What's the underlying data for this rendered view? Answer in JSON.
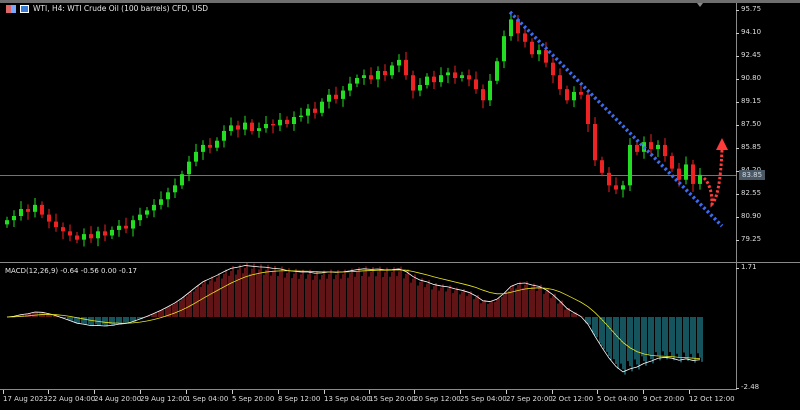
{
  "window": {
    "title": "WTI, H4:  WTI Crude Oil (100 barrels) CFD, USD"
  },
  "indicator": {
    "label": "MACD(12,26,9) -0.64 -0.56 0.00 -0.17",
    "max_label": "1.71",
    "min_label": "-2.48",
    "fast": 12,
    "slow": 26,
    "signal": 9
  },
  "price_axis": {
    "labels": [
      "95.75",
      "94.10",
      "92.45",
      "90.80",
      "89.15",
      "87.50",
      "85.85",
      "84.20",
      "82.55",
      "80.90",
      "79.25"
    ],
    "current_price": "83.85"
  },
  "time_axis": {
    "labels": [
      "17 Aug 2023",
      "22 Aug 04:00",
      "24 Aug 20:00",
      "29 Aug 12:00",
      "1 Sep 04:00",
      "5 Sep 20:00",
      "8 Sep 12:00",
      "13 Sep 04:00",
      "15 Sep 20:00",
      "20 Sep 12:00",
      "25 Sep 04:00",
      "27 Sep 20:00",
      "2 Oct 12:00",
      "5 Oct 04:00",
      "9 Oct 20:00",
      "12 Oct 12:00"
    ]
  },
  "colors": {
    "bull": "#22dd22",
    "bear": "#ee2222",
    "trendline": "#3b6cf0",
    "arrow": "#ff3b3b",
    "macd": "#ffffff",
    "signal": "#e8e820",
    "hist_pos": "#c0282a",
    "hist_neg": "#2aa8b8"
  },
  "chart_data": {
    "type": "candlestick",
    "symbol": "WTI",
    "timeframe": "H4",
    "ylim": [
      78.6,
      96.1
    ],
    "closes": [
      80.6,
      80.9,
      81.4,
      81.2,
      81.7,
      81.0,
      80.5,
      80.1,
      79.8,
      79.5,
      79.2,
      79.6,
      79.3,
      79.8,
      79.5,
      79.9,
      80.2,
      80.0,
      80.6,
      81.0,
      81.3,
      81.7,
      82.1,
      82.6,
      83.1,
      83.9,
      84.8,
      85.5,
      86.0,
      85.8,
      86.3,
      87.0,
      87.4,
      87.1,
      87.6,
      87.0,
      87.2,
      87.5,
      87.4,
      87.8,
      87.5,
      88.0,
      88.1,
      88.6,
      88.3,
      89.1,
      89.6,
      89.3,
      89.9,
      90.4,
      90.8,
      91.0,
      90.7,
      91.3,
      91.0,
      91.7,
      92.1,
      91.0,
      89.9,
      90.3,
      90.9,
      90.5,
      91.0,
      91.2,
      90.8,
      91.0,
      90.7,
      90.0,
      89.2,
      90.6,
      92.0,
      93.8,
      95.0,
      94.0,
      93.4,
      92.5,
      92.8,
      91.9,
      91.0,
      90.0,
      89.2,
      89.8,
      89.6,
      87.5,
      84.9,
      84.0,
      83.1,
      82.8,
      83.1,
      86.0,
      85.5,
      86.2,
      85.7,
      86.0,
      85.2,
      84.3,
      83.5,
      84.6,
      83.2,
      83.85
    ]
  }
}
